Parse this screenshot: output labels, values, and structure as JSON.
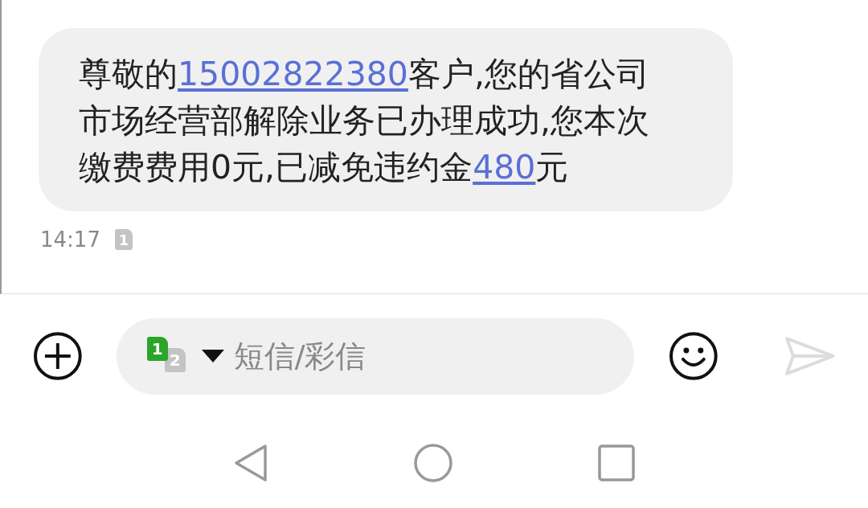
{
  "messages": [
    {
      "segments": [
        {
          "kind": "text",
          "text": "尊敬的"
        },
        {
          "kind": "link",
          "text": "15002822380"
        },
        {
          "kind": "text",
          "text": "客户,您的省公司市场经营部解除业务已办理成功,您本次缴费费用0元,已减免违约金"
        },
        {
          "kind": "link",
          "text": "480"
        },
        {
          "kind": "text",
          "text": "元"
        }
      ],
      "time": "14:17",
      "sim": "1"
    }
  ],
  "composer": {
    "sim_primary": "1",
    "sim_secondary": "2",
    "placeholder": "短信/彩信",
    "send_disabled": true
  }
}
